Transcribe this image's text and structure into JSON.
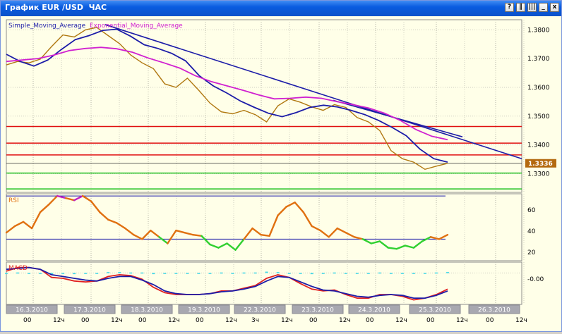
{
  "window": {
    "title": "График EUR /USD  ЧАС",
    "buttons": {
      "help": "?",
      "split": "‖",
      "bars": "|||",
      "minimize": "_",
      "maximize": "□",
      "close": "x"
    }
  },
  "main_panel": {
    "labels": {
      "sma": "Simple_Moving_Average",
      "ema": "Exponential_Moving_Average"
    },
    "ticks": [
      "1.3800",
      "1.3700",
      "1.3600",
      "1.3500",
      "1.3400",
      "1.3300"
    ],
    "current_price": "1.3336",
    "colors": {
      "price": "#b07810",
      "sma": "#1c1ca8",
      "ema": "#d020d0",
      "resistance": "#e01010",
      "support": "#20c020",
      "trendline": "#1c1ca8",
      "price_tag": "#b46a10"
    }
  },
  "rsi_panel": {
    "label": "RSI",
    "ticks": [
      "60",
      "40",
      "20"
    ]
  },
  "macd_panel": {
    "label": "MACD",
    "ticks": [
      "-0.00"
    ]
  },
  "time_axis": {
    "dates": [
      "16.3.2010",
      "17.3.2010",
      "18.3.2010",
      "19.3.2010",
      "22.3.2010",
      "23.3.2010",
      "24.3.2010",
      "25.3.2010",
      "26.3.2010"
    ],
    "hours": [
      "00",
      "12ч",
      "00",
      "12ч",
      "00",
      "12ч",
      "00",
      "12ч",
      "3ч",
      "12ч",
      "00",
      "12ч",
      "00",
      "12ч",
      "00",
      "12ч",
      "00",
      "12ч"
    ]
  },
  "chart_data": {
    "type": "line",
    "instrument": "EUR/USD",
    "timeframe": "ЧАС",
    "ylim": [
      1.3235,
      1.3835
    ],
    "x_dates": [
      "16.3.2010",
      "17.3.2010",
      "18.3.2010",
      "19.3.2010",
      "22.3.2010",
      "23.3.2010",
      "24.3.2010",
      "25.3.2010",
      "26.3.2010"
    ],
    "series": [
      {
        "name": "Simple_Moving_Average",
        "values": [
          1.3715,
          1.369,
          1.3674,
          1.3695,
          1.3732,
          1.3766,
          1.378,
          1.3798,
          1.3802,
          1.3778,
          1.3748,
          1.3735,
          1.3718,
          1.3692,
          1.364,
          1.3605,
          1.358,
          1.3552,
          1.353,
          1.351,
          1.3498,
          1.3512,
          1.353,
          1.3538,
          1.3532,
          1.352,
          1.3505,
          1.3485,
          1.346,
          1.3432,
          1.3385,
          1.3352,
          1.334
        ]
      },
      {
        "name": "Exponential_Moving_Average",
        "values": [
          1.369,
          1.3695,
          1.37,
          1.3712,
          1.3728,
          1.3735,
          1.3739,
          1.3734,
          1.3722,
          1.3702,
          1.3685,
          1.3667,
          1.364,
          1.362,
          1.3605,
          1.359,
          1.3574,
          1.356,
          1.3562,
          1.3566,
          1.3562,
          1.355,
          1.354,
          1.3528,
          1.351,
          1.3485,
          1.3453,
          1.343,
          1.3418
        ]
      }
    ],
    "close": [
      1.3678,
      1.369,
      1.3685,
      1.3698,
      1.3742,
      1.3782,
      1.3775,
      1.38,
      1.3808,
      1.378,
      1.3752,
      1.3712,
      1.3685,
      1.3665,
      1.3612,
      1.36,
      1.3632,
      1.359,
      1.3545,
      1.3515,
      1.3508,
      1.352,
      1.3505,
      1.348,
      1.3536,
      1.356,
      1.3548,
      1.3532,
      1.352,
      1.354,
      1.353,
      1.3495,
      1.348,
      1.345,
      1.338,
      1.3352,
      1.334,
      1.3315,
      1.3326,
      1.3336
    ],
    "horizontal_levels": {
      "resistance": [
        1.3464,
        1.3406,
        1.3365
      ],
      "support": [
        1.3302,
        1.3247
      ],
      "current": 1.3336
    },
    "trendlines": [
      {
        "from": [
          "17.3.2010",
          1.3818
        ],
        "to": [
          "26.3.2010",
          1.3352
        ]
      },
      {
        "from": [
          "23.3.2010",
          1.3555
        ],
        "to": [
          "25.3.2010",
          1.3428
        ]
      }
    ],
    "rsi": {
      "ylim": [
        10,
        72
      ],
      "levels": [
        70,
        30
      ],
      "values": [
        36,
        42,
        46,
        40,
        55,
        62,
        70,
        68,
        66,
        70,
        65,
        55,
        48,
        45,
        40,
        34,
        30,
        38,
        32,
        26,
        38,
        36,
        34,
        33,
        25,
        22,
        26,
        20,
        30,
        40,
        34,
        33,
        52,
        60,
        64,
        55,
        42,
        38,
        32,
        40,
        36,
        32,
        30,
        26,
        28,
        22,
        21,
        24,
        22,
        28,
        32,
        30,
        34
      ]
    },
    "macd": {
      "macd": [
        0.2,
        0.6,
        0.6,
        0.4,
        -0.5,
        -0.6,
        -0.9,
        -1.0,
        -0.9,
        -0.4,
        -0.2,
        -0.3,
        -0.7,
        -1.6,
        -2.2,
        -2.4,
        -2.4,
        -2.4,
        -2.3,
        -2.0,
        -2.0,
        -1.7,
        -1.4,
        -0.6,
        -0.2,
        -0.5,
        -1.2,
        -1.8,
        -2.0,
        -1.9,
        -2.4,
        -2.8,
        -2.8,
        -2.4,
        -2.4,
        -2.6,
        -3.0,
        -2.8,
        -2.4,
        -1.8
      ],
      "signal": [
        0.4,
        0.5,
        0.6,
        0.4,
        -0.2,
        -0.4,
        -0.6,
        -0.8,
        -0.9,
        -0.6,
        -0.4,
        -0.4,
        -0.8,
        -1.3,
        -2.0,
        -2.3,
        -2.4,
        -2.4,
        -2.3,
        -2.1,
        -2.0,
        -1.8,
        -1.5,
        -0.9,
        -0.4,
        -0.5,
        -1.0,
        -1.5,
        -1.9,
        -2.0,
        -2.3,
        -2.6,
        -2.7,
        -2.5,
        -2.4,
        -2.5,
        -2.8,
        -2.8,
        -2.5,
        -2.0
      ]
    }
  }
}
